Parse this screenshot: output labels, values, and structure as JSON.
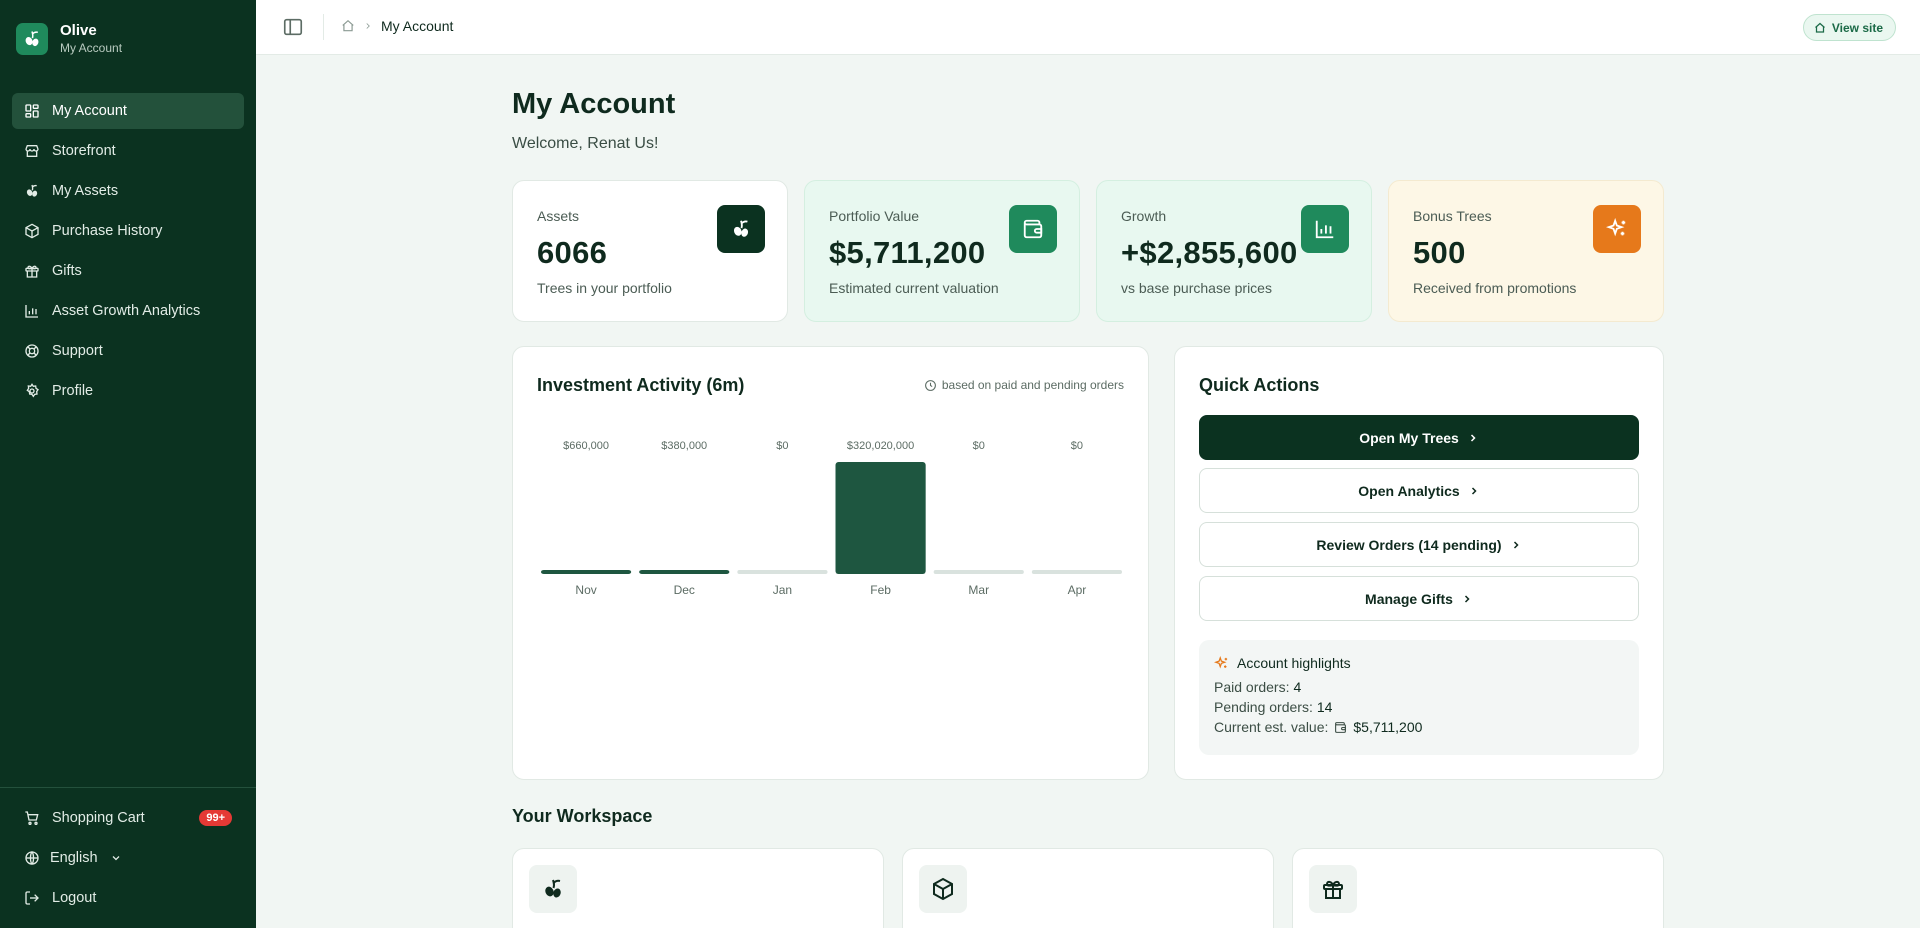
{
  "app": {
    "name": "Olive",
    "subtitle": "My Account"
  },
  "sidebar": {
    "items": [
      {
        "label": "My Account",
        "icon": "dashboard-icon",
        "active": true
      },
      {
        "label": "Storefront",
        "icon": "store-icon"
      },
      {
        "label": "My Assets",
        "icon": "olive-icon"
      },
      {
        "label": "Purchase History",
        "icon": "package-icon"
      },
      {
        "label": "Gifts",
        "icon": "gift-icon"
      },
      {
        "label": "Asset Growth Analytics",
        "icon": "bar-chart-icon"
      },
      {
        "label": "Support",
        "icon": "lifebuoy-icon"
      },
      {
        "label": "Profile",
        "icon": "gear-icon"
      }
    ],
    "bottom": {
      "cart_label": "Shopping Cart",
      "cart_badge": "99+",
      "language": "English",
      "logout": "Logout"
    }
  },
  "topbar": {
    "breadcrumb_current": "My Account",
    "view_site": "View site"
  },
  "page": {
    "title": "My Account",
    "welcome": "Welcome, Renat Us!"
  },
  "stats": [
    {
      "label": "Assets",
      "value": "6066",
      "sub": "Trees in your portfolio",
      "icon": "olive-icon",
      "color": "#0b3220"
    },
    {
      "label": "Portfolio Value",
      "value": "$5,711,200",
      "sub": "Estimated current valuation",
      "icon": "wallet-icon",
      "color": "#1f8a5c"
    },
    {
      "label": "Growth",
      "value": "+$2,855,600",
      "sub": "vs base purchase prices",
      "icon": "bar-chart-icon",
      "color": "#1f8a5c"
    },
    {
      "label": "Bonus Trees",
      "value": "500",
      "sub": "Received from promotions",
      "icon": "sparkles-icon",
      "color": "#e6791b"
    }
  ],
  "activity": {
    "title": "Investment Activity (6m)",
    "note": "based on paid and pending orders"
  },
  "chart_data": {
    "type": "bar",
    "categories": [
      "Nov",
      "Dec",
      "Jan",
      "Feb",
      "Mar",
      "Apr"
    ],
    "values": [
      660000,
      380000,
      0,
      320020000,
      0,
      0
    ],
    "value_labels": [
      "$660,000",
      "$380,000",
      "$0",
      "$320,020,000",
      "$0",
      "$0"
    ],
    "title": "Investment Activity (6m)",
    "colors": {
      "bar": "#1e5640",
      "track": "#d9e2de"
    }
  },
  "quick_actions": {
    "title": "Quick Actions",
    "buttons": [
      "Open My Trees",
      "Open Analytics",
      "Review Orders (14 pending)",
      "Manage Gifts"
    ],
    "highlights": {
      "title": "Account highlights",
      "paid_label": "Paid orders:",
      "paid_value": "4",
      "pending_label": "Pending orders:",
      "pending_value": "14",
      "value_label": "Current est. value:",
      "value_value": "$5,711,200"
    }
  },
  "workspace": {
    "title": "Your Workspace",
    "cards": [
      {
        "icon": "olive-icon"
      },
      {
        "icon": "package-icon"
      },
      {
        "icon": "gift-icon"
      }
    ]
  }
}
